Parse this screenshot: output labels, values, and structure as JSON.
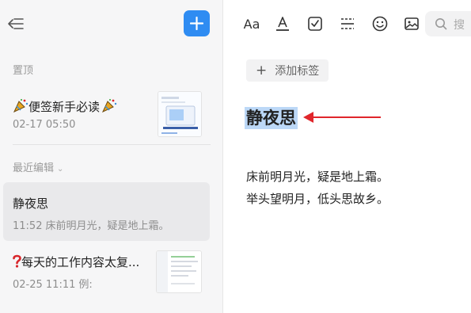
{
  "sidebar": {
    "sections": {
      "pinned": "置顶",
      "recent": "最近编辑"
    },
    "notes": [
      {
        "title": "便签新手必读",
        "date": "02-17 05:50",
        "preview": "",
        "has_thumbnail": true,
        "emoji": "party-popper"
      },
      {
        "title": "静夜思",
        "date": "11:52",
        "preview": "床前明月光，疑是地上霜。",
        "selected": true
      },
      {
        "title": "每天的工作内容太复...",
        "date": "02-25 11:11",
        "preview": "例:",
        "has_thumbnail": true,
        "emoji": "red-question-mark"
      }
    ]
  },
  "toolbar": {
    "font_label": "Aa",
    "search_placeholder": "搜"
  },
  "editor": {
    "add_tag_label": "添加标签",
    "title": "静夜思",
    "body": [
      "床前明月光，疑是地上霜。",
      "举头望明月，低头思故乡。"
    ]
  },
  "colors": {
    "accent": "#2f8cf2",
    "selection": "#bcd8f7",
    "arrow": "#e0262b",
    "sidebar_bg": "#f6f6f7"
  }
}
